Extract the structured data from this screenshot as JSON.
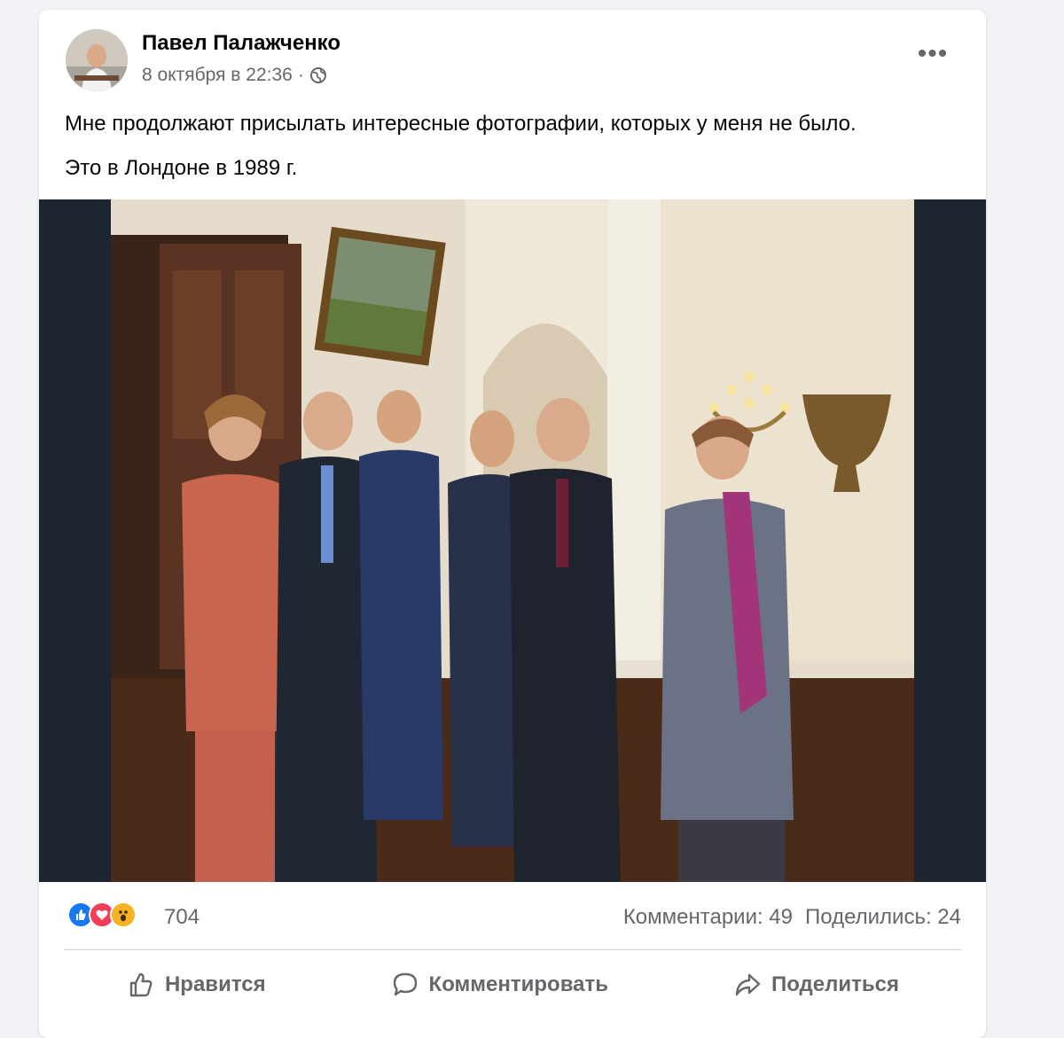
{
  "post": {
    "author": "Павел Палажченко",
    "date": "8 октября в 22:36",
    "separator": "·",
    "more_label": "•••",
    "text_line1": "Мне продолжают присылать интересные фотографии, которых у меня не было.",
    "text_line2": "Это в Лондоне в 1989 г."
  },
  "reactions": {
    "icons": [
      "like-icon",
      "love-icon",
      "wow-icon"
    ],
    "count": "704",
    "comments": "Комментарии: 49",
    "shares": "Поделились: 24"
  },
  "actions": {
    "like": "Нравится",
    "comment": "Комментировать",
    "share": "Поделиться"
  },
  "colors": {
    "like": "#1877f2",
    "love": "#f33e58",
    "wow": "#f7b125",
    "photo_bg": "#1c2530"
  }
}
